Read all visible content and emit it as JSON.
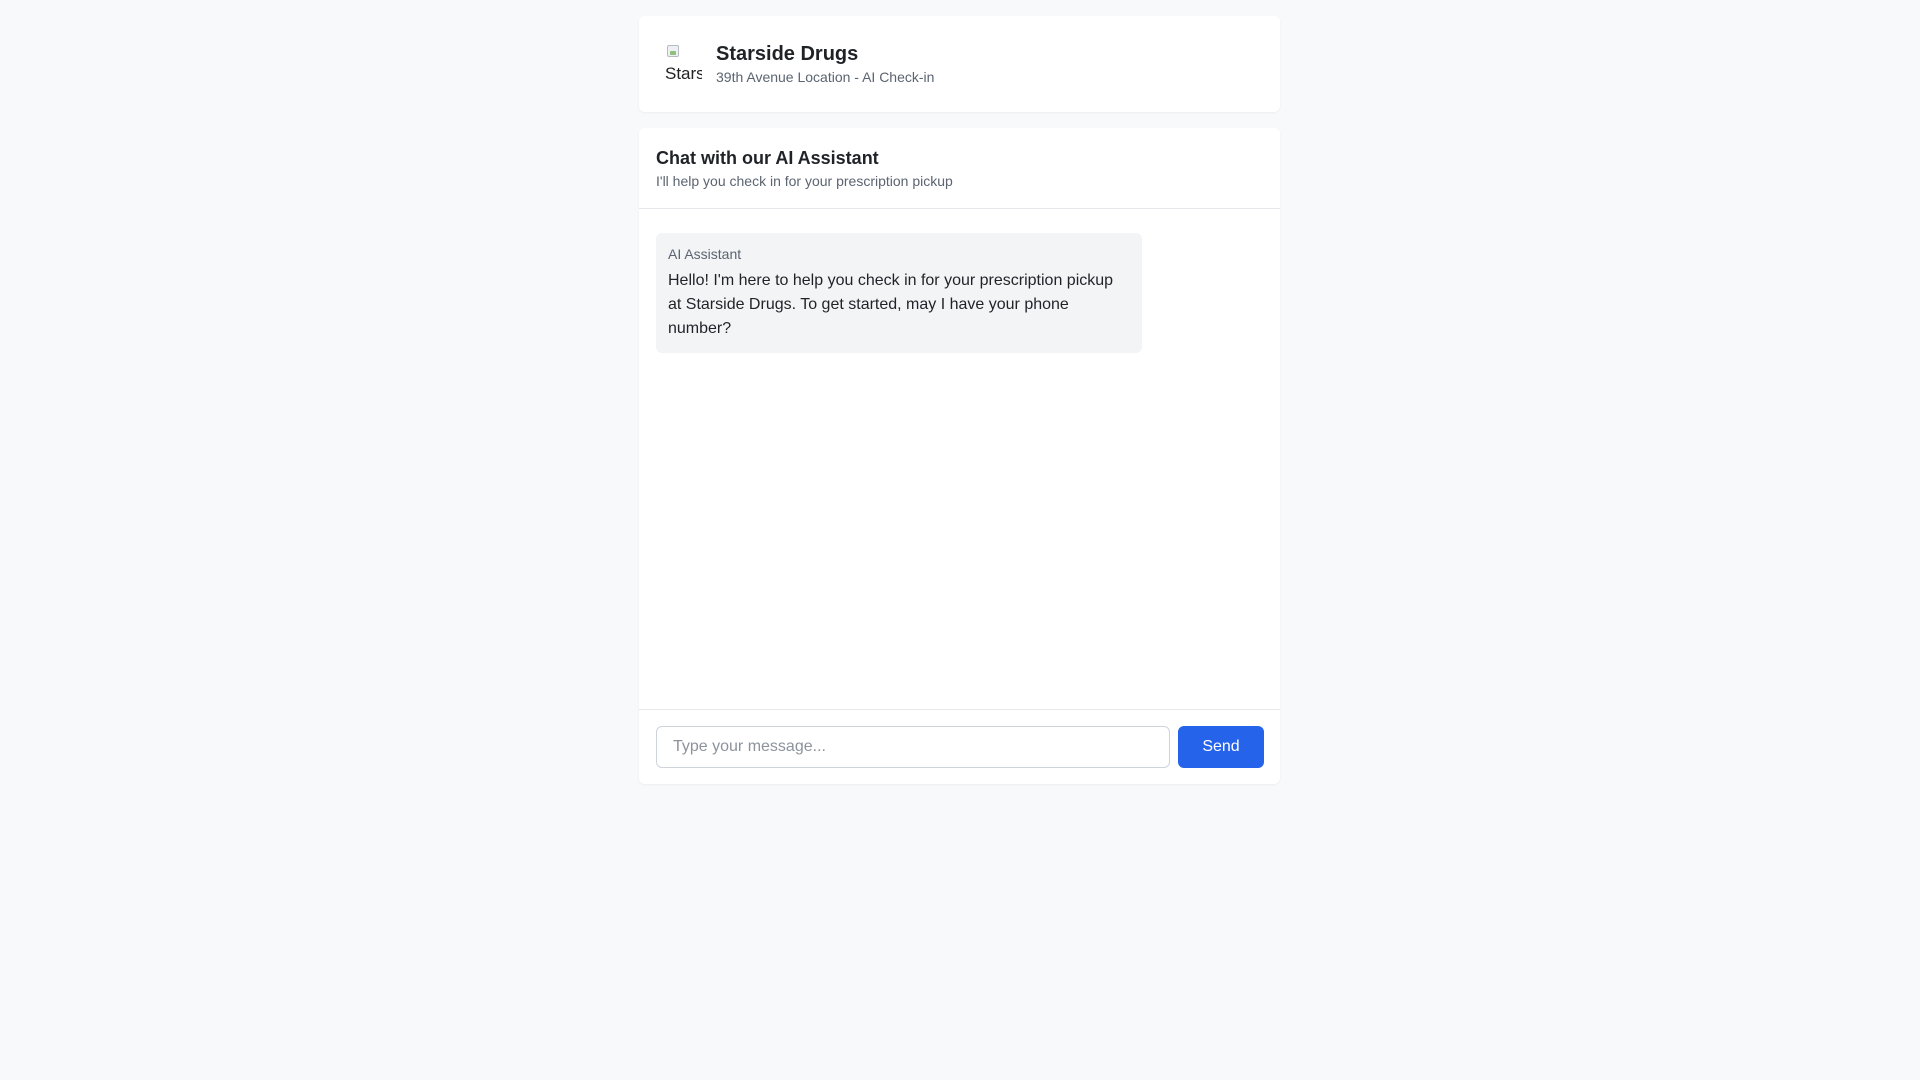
{
  "header": {
    "logo_alt": "Starside Drugs",
    "brand_name": "Starside Drugs",
    "subtitle": "39th Avenue Location - AI Check-in"
  },
  "chat": {
    "title": "Chat with our AI Assistant",
    "subtitle": "I'll help you check in for your prescription pickup",
    "messages": [
      {
        "sender": "AI Assistant",
        "text": "Hello! I'm here to help you check in for your prescription pickup at Starside Drugs. To get started, may I have your phone number?"
      }
    ],
    "input": {
      "value": "",
      "placeholder": "Type your message..."
    },
    "send_label": "Send"
  },
  "colors": {
    "background": "#f8f9fb",
    "accent": "#2563eb",
    "bubble": "#f3f4f6"
  },
  "icons": {
    "logo": "broken-image-icon"
  }
}
